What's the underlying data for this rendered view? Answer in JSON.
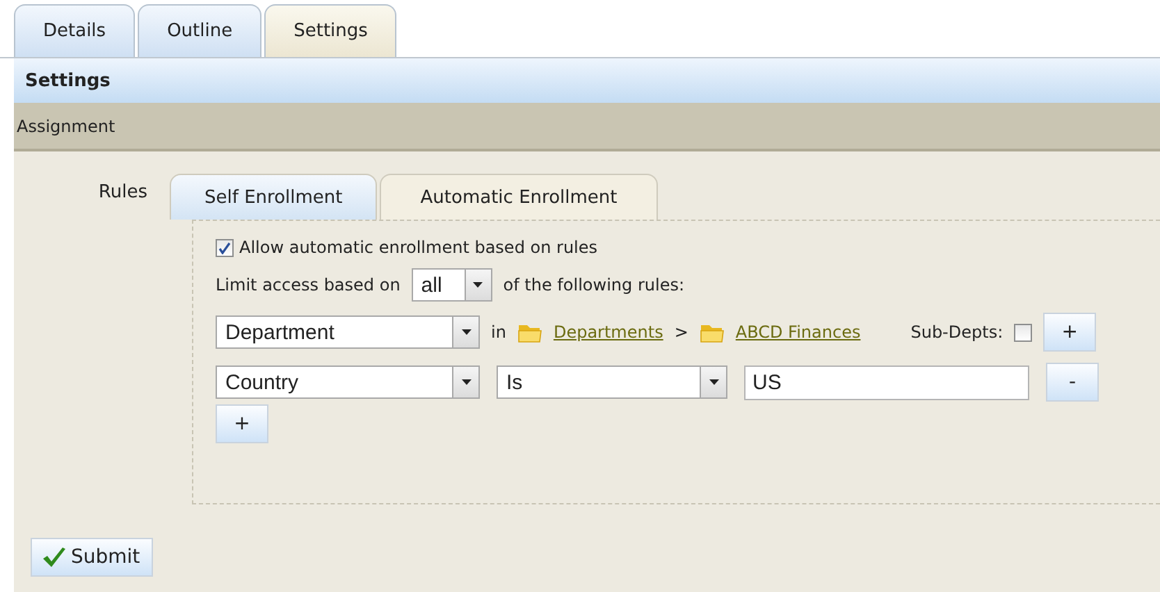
{
  "tabs": [
    {
      "label": "Details",
      "selected": false
    },
    {
      "label": "Outline",
      "selected": false
    },
    {
      "label": "Settings",
      "selected": true
    }
  ],
  "header": "Settings",
  "section": "Assignment",
  "rules_label": "Rules",
  "inner_tabs": [
    {
      "label": "Self Enrollment",
      "selected": false
    },
    {
      "label": "Automatic Enrollment",
      "selected": true
    }
  ],
  "allow": {
    "label": "Allow automatic enrollment based on rules",
    "checked": true
  },
  "limit": {
    "prefix": "Limit access based on",
    "value": "all",
    "suffix": "of the following rules:"
  },
  "rules": [
    {
      "kind": "department",
      "field": "Department",
      "connector": "in",
      "path": [
        {
          "label": "Departments"
        },
        {
          "label": "ABCD Finances"
        }
      ],
      "separator": ">",
      "subdepts": {
        "label": "Sub-Depts:",
        "checked": false
      },
      "button": "+"
    },
    {
      "kind": "condition",
      "field": "Country",
      "operator": "Is",
      "value": "US",
      "button": "-"
    }
  ],
  "add_button": "+",
  "submit": "Submit"
}
